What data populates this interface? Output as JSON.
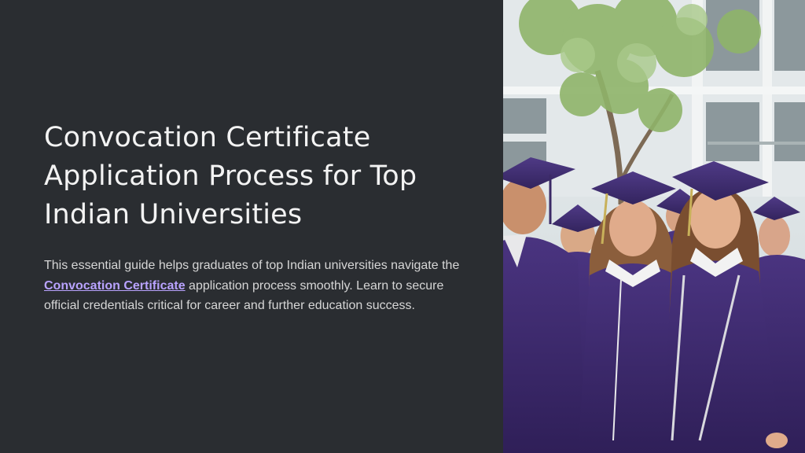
{
  "slide": {
    "title_lines": [
      "Convocation Certificate",
      "Application Process for Top",
      "Indian Universities"
    ],
    "body": {
      "before_link": "This essential guide helps graduates of top Indian universities navigate the ",
      "link_text": "Convocation Certificate",
      "after_link": " application process smoothly. Learn to secure official credentials critical for career and further education success."
    }
  },
  "colors": {
    "background": "#2a2d31",
    "title": "#f3f3f3",
    "body": "#d6d6d6",
    "link": "#b9a3ff",
    "gown": "#3f2a6e"
  },
  "image": {
    "subject": "graduates in purple caps and gowns outdoors"
  }
}
